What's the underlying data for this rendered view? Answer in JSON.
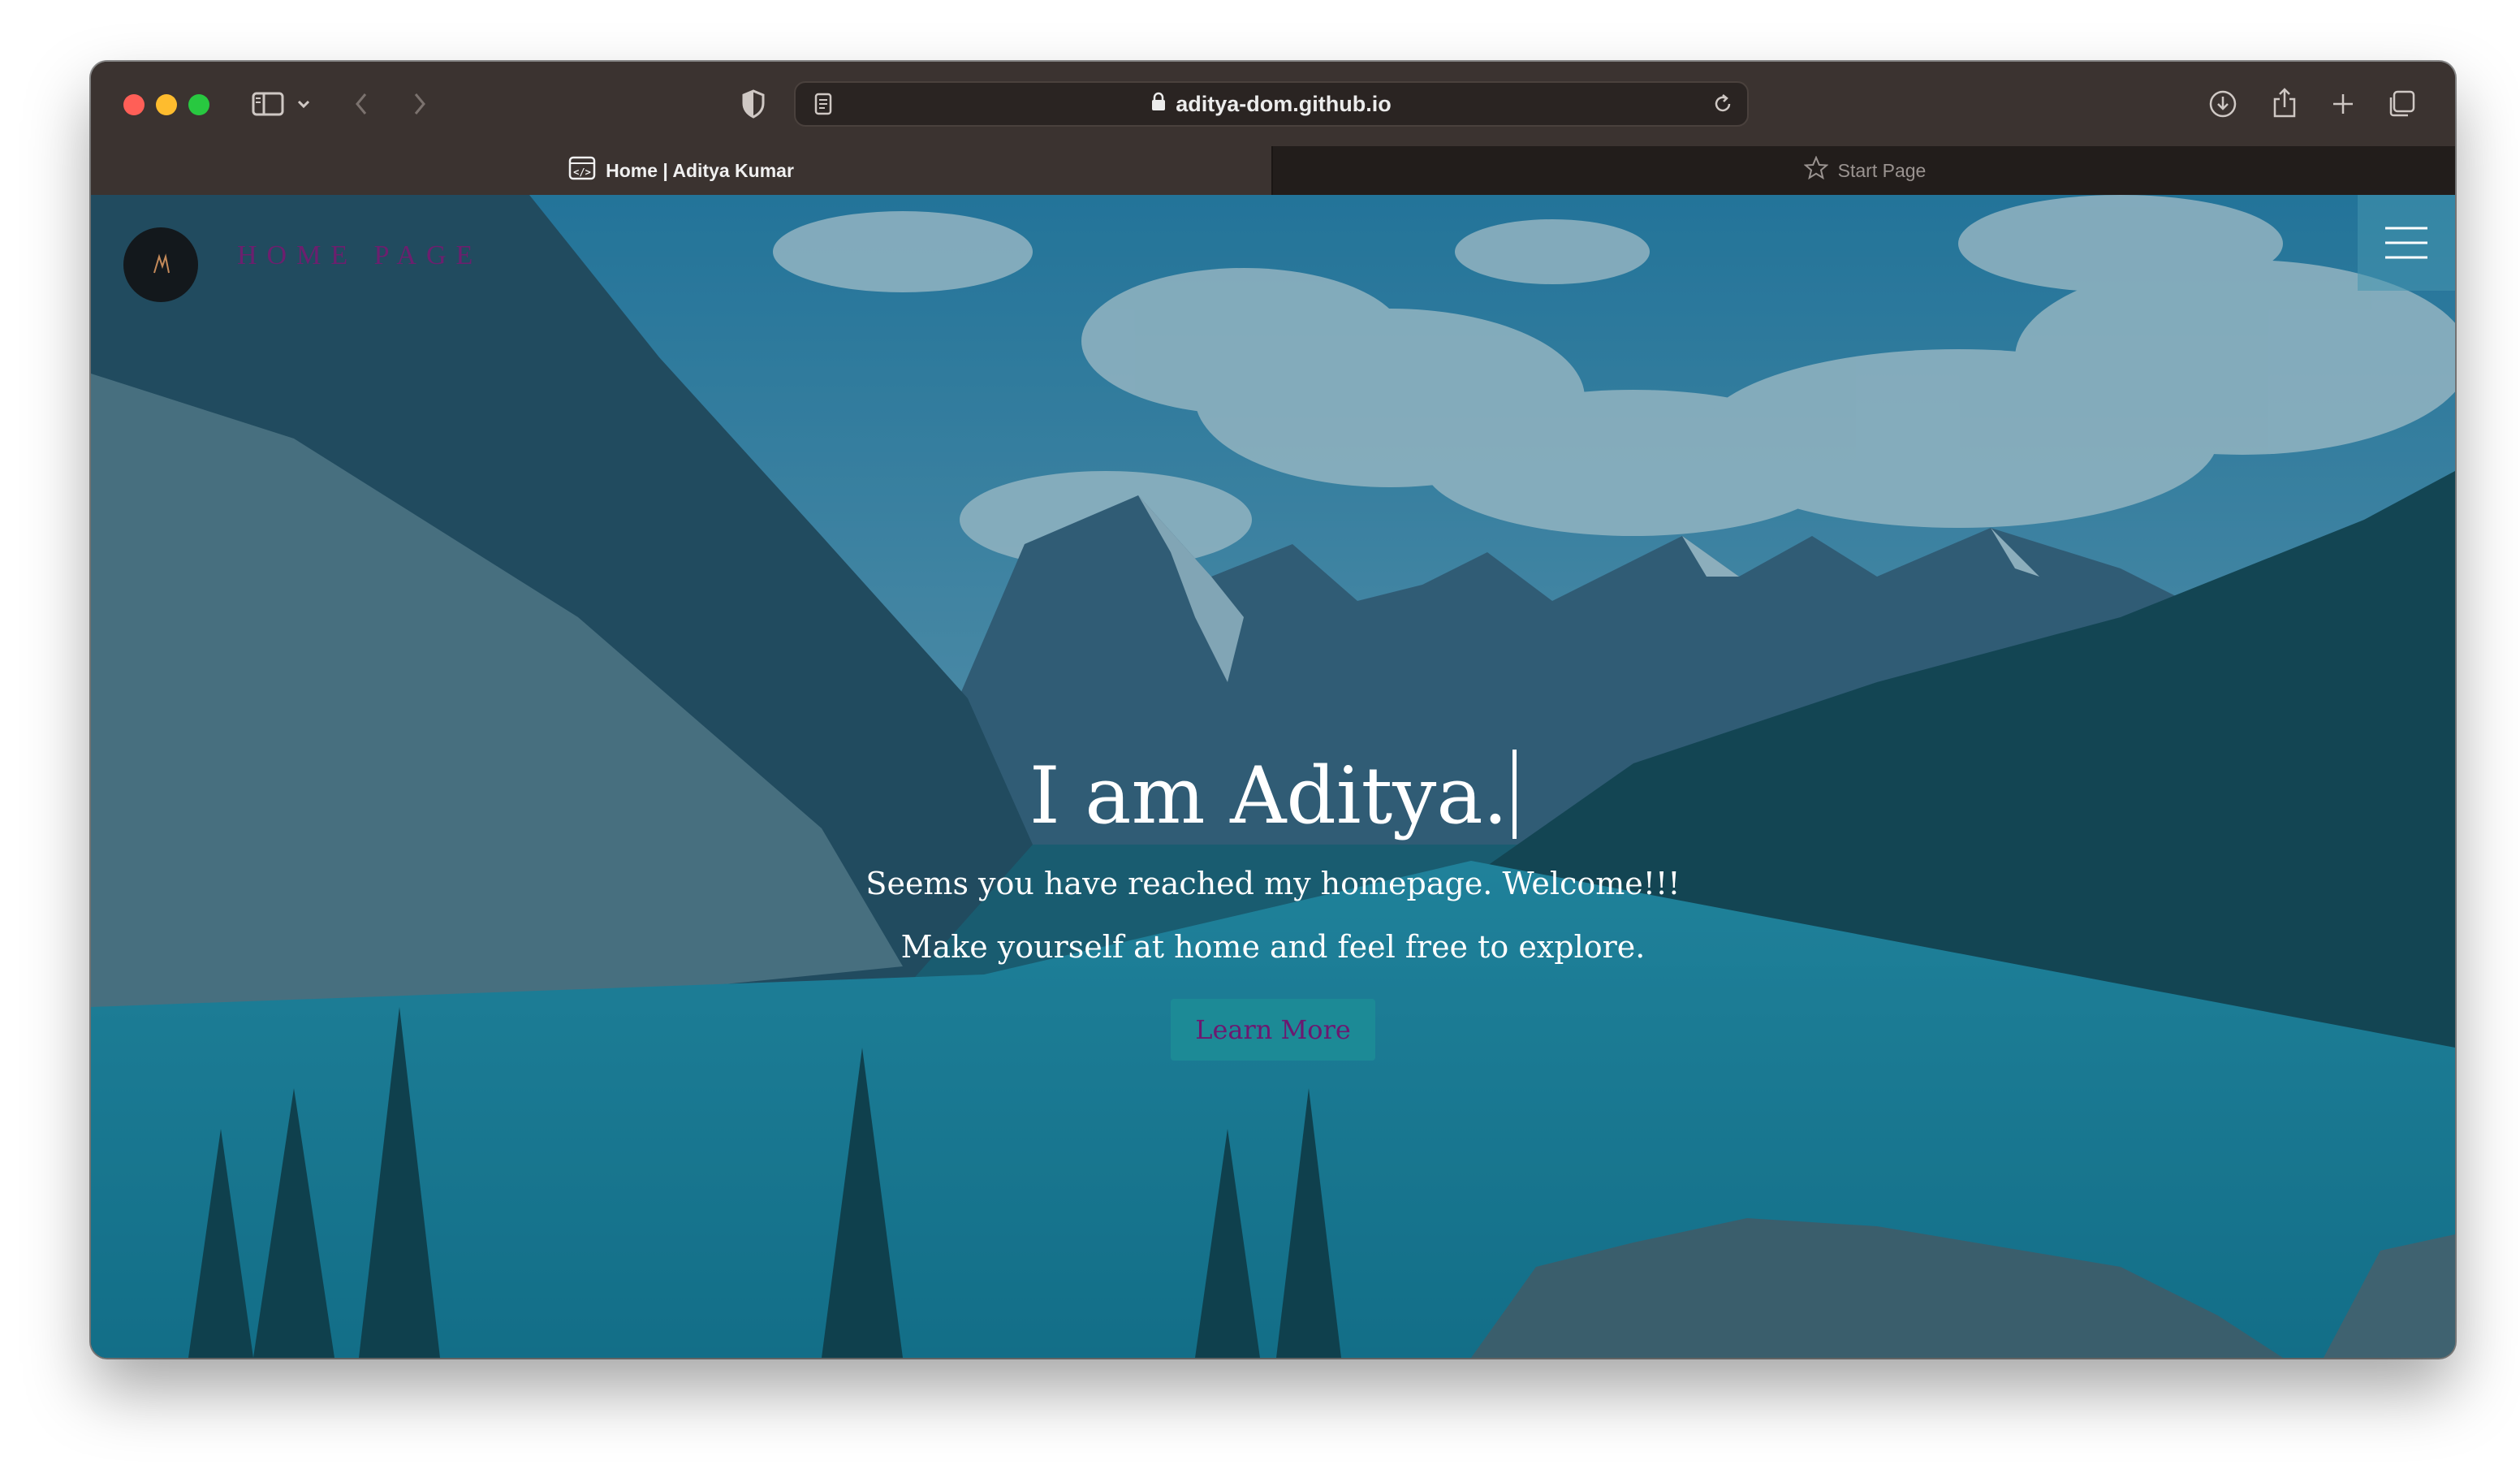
{
  "browser": {
    "url": "aditya-dom.github.io",
    "tabs": [
      {
        "label": "Home | Aditya Kumar",
        "active": true
      },
      {
        "label": "Start Page",
        "active": false
      }
    ]
  },
  "site": {
    "nav_link": "HOME PAGE",
    "hero": {
      "title": "I am Aditya.",
      "line1": "Seems you have reached my homepage. Welcome!!!",
      "line2": "Make yourself at home and feel free to explore.",
      "button": "Learn More"
    }
  },
  "colors": {
    "overlay": "#10587099",
    "accent_purple": "#6c1f6e",
    "button_bg": "#1c8a96"
  },
  "icons": {
    "logo": "stylized-letter-logo",
    "menu": "hamburger-icon"
  }
}
